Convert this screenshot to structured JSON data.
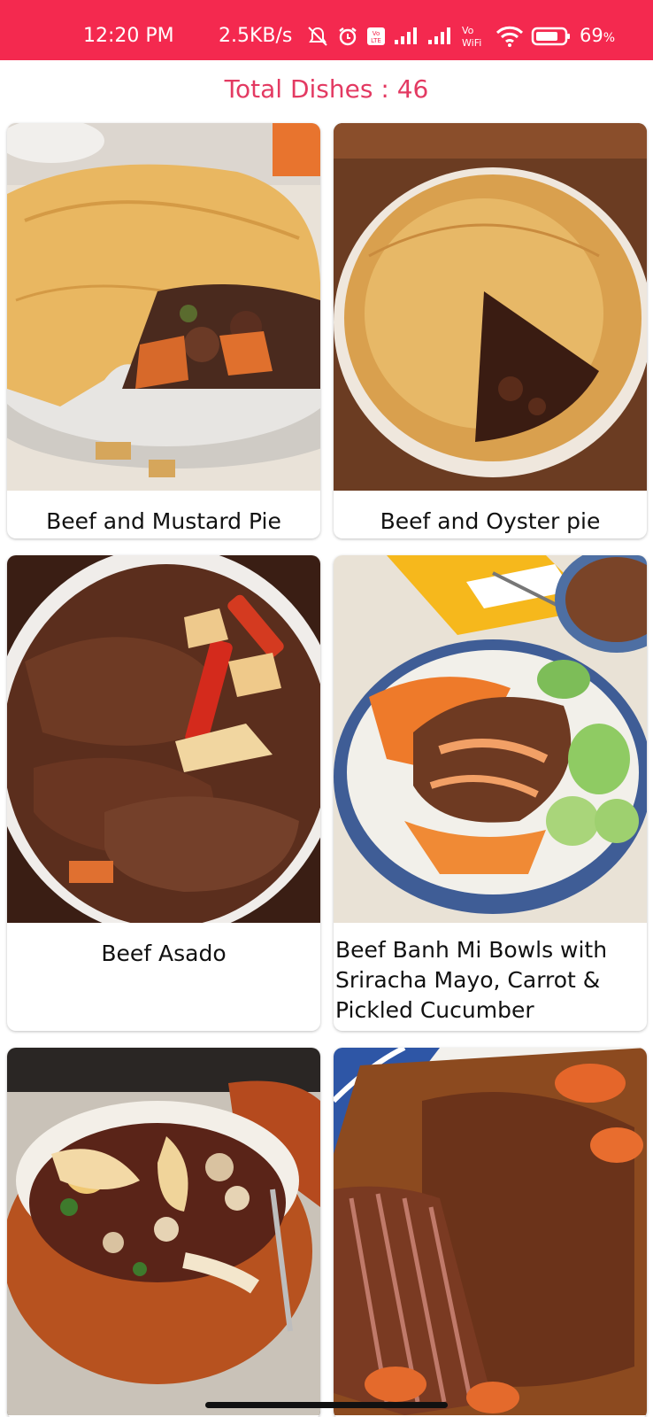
{
  "status_bar": {
    "time": "12:20 PM",
    "speed": "2.5KB/s",
    "battery_percent": "69",
    "battery_suffix": "%",
    "icons": [
      "mute-icon",
      "alarm-icon",
      "volte-icon",
      "signal-icon",
      "signal-icon",
      "vowifi-icon",
      "wifi-icon",
      "battery-icon"
    ]
  },
  "header": {
    "title": "Total Dishes : 46"
  },
  "dishes": [
    {
      "name": "Beef and Mustard Pie"
    },
    {
      "name": "Beef and Oyster pie"
    },
    {
      "name": "Beef Asado"
    },
    {
      "name": "Beef Banh Mi Bowls with Sriracha Mayo, Carrot & Pickled Cucumber"
    },
    {
      "name": ""
    },
    {
      "name": ""
    }
  ],
  "colors": {
    "status_bar": "#F4294F",
    "title": "#E33A62"
  }
}
